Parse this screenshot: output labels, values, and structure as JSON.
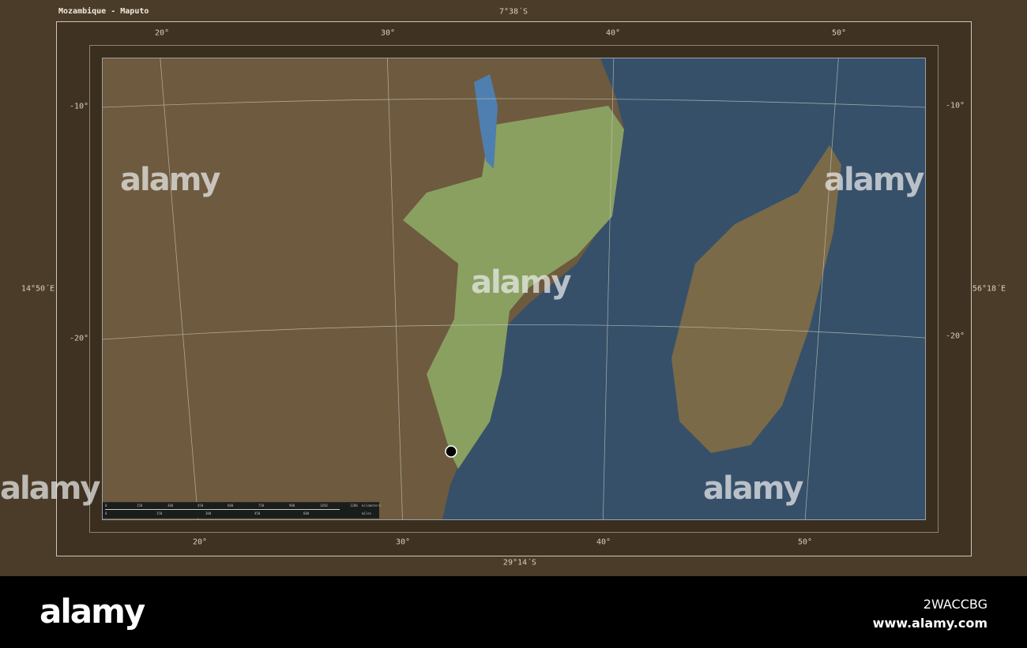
{
  "title": "Mozambique - Maputo",
  "bounds": {
    "north": "7°38´S",
    "south": "29°14´S",
    "west": "14°50´E",
    "east": "56°18´E"
  },
  "top_longitudes": [
    "20°",
    "30°",
    "40°",
    "50°"
  ],
  "bottom_longitudes": [
    "20°",
    "30°",
    "40°",
    "50°"
  ],
  "left_latitudes": [
    "-10°",
    "-20°"
  ],
  "right_latitudes": [
    "-10°",
    "-20°"
  ],
  "scale_bar": {
    "km_ticks": [
      "0",
      "150",
      "300",
      "450",
      "600",
      "750",
      "900",
      "1050",
      "1200"
    ],
    "km_unit": "kilometers",
    "mi_ticks": [
      "0",
      "150",
      "300",
      "450",
      "600"
    ],
    "mi_unit": "miles"
  },
  "marker": {
    "name": "Maputo",
    "color": "#000000"
  },
  "colors": {
    "highlight": "#8aa060",
    "ocean": "#36506a",
    "land": "#6e5a3e"
  },
  "watermark": "alamy",
  "footer": {
    "logo": "alamy",
    "image_id": "2WACCBG",
    "url": "www.alamy.com"
  }
}
